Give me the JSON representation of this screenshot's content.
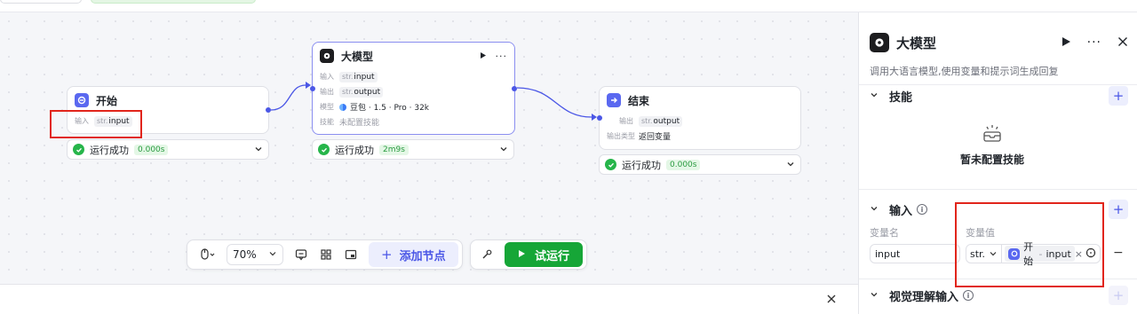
{
  "canvas": {
    "nodes": {
      "start": {
        "title": "开始",
        "input_label": "输入",
        "input_type": "str.",
        "input_name": "input"
      },
      "llm": {
        "title": "大模型",
        "input_label": "输入",
        "input_type": "str.",
        "input_name": "input",
        "output_label": "输出",
        "output_type": "str.",
        "output_name": "output",
        "model_label": "模型",
        "model_value": "豆包 · 1.5 · Pro · 32k",
        "skill_label": "技能",
        "skill_value": "未配置技能"
      },
      "end": {
        "title": "结束",
        "output_label": "输出",
        "output_type": "str.",
        "output_name": "output",
        "output_kind_label": "输出类型",
        "output_kind_value": "返回变量"
      }
    },
    "statuses": {
      "start": {
        "text": "运行成功",
        "time": "0.000s"
      },
      "llm": {
        "text": "运行成功",
        "time": "2m9s"
      },
      "end": {
        "text": "运行成功",
        "time": "0.000s"
      }
    }
  },
  "toolbar": {
    "zoom": "70%",
    "add_node_label": "添加节点",
    "run_label": "试运行"
  },
  "panel": {
    "title": "大模型",
    "description": "调用大语言模型,使用变量和提示词生成回复",
    "skills": {
      "title": "技能",
      "empty_text": "暂未配置技能"
    },
    "inputs": {
      "title": "输入",
      "col_name": "变量名",
      "col_value": "变量值",
      "var_name": "input",
      "var_type": "str.",
      "ref_node": "开始",
      "ref_sep": "-",
      "ref_var": "input"
    },
    "vision": {
      "title": "视觉理解输入"
    }
  },
  "colors": {
    "accent": "#4b57e6",
    "success": "#26b54a",
    "run_button": "#16a637",
    "highlight_box": "#e1251b"
  }
}
